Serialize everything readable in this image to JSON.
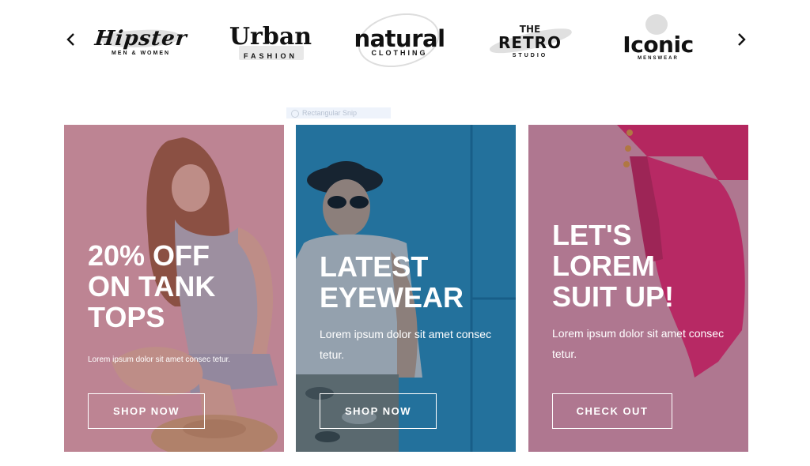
{
  "carousel": {
    "prev_icon": "chevron-left-icon",
    "next_icon": "chevron-right-icon",
    "brands": [
      {
        "name": "Hipster",
        "tagline": "MEN & WOMEN"
      },
      {
        "name": "Urban",
        "tagline": "FASHION"
      },
      {
        "name": "natural",
        "tagline": "CLOTHING"
      },
      {
        "name_top": "THE",
        "name": "RETRO",
        "tagline": "STUDIO"
      },
      {
        "name": "Iconic",
        "tagline": "MENSWEAR"
      }
    ]
  },
  "ghost_label": "Rectangular Snip",
  "promos": [
    {
      "headline": "20% OFF\nON TANK\nTOPS",
      "blurb": "Lorem ipsum dolor sit amet consec tetur.",
      "cta": "SHOP NOW",
      "color": "#e8aab6"
    },
    {
      "headline": "LATEST\nEYEWEAR",
      "blurb": "Lorem ipsum dolor sit amet consec tetur.",
      "cta": "SHOP NOW",
      "color": "#2aa0d4"
    },
    {
      "headline": "LET'S\nLOREM\nSUIT UP!",
      "blurb": "Lorem ipsum dolor sit amet consec tetur.",
      "cta": "CHECK OUT",
      "color": "#cf9ab2"
    }
  ]
}
